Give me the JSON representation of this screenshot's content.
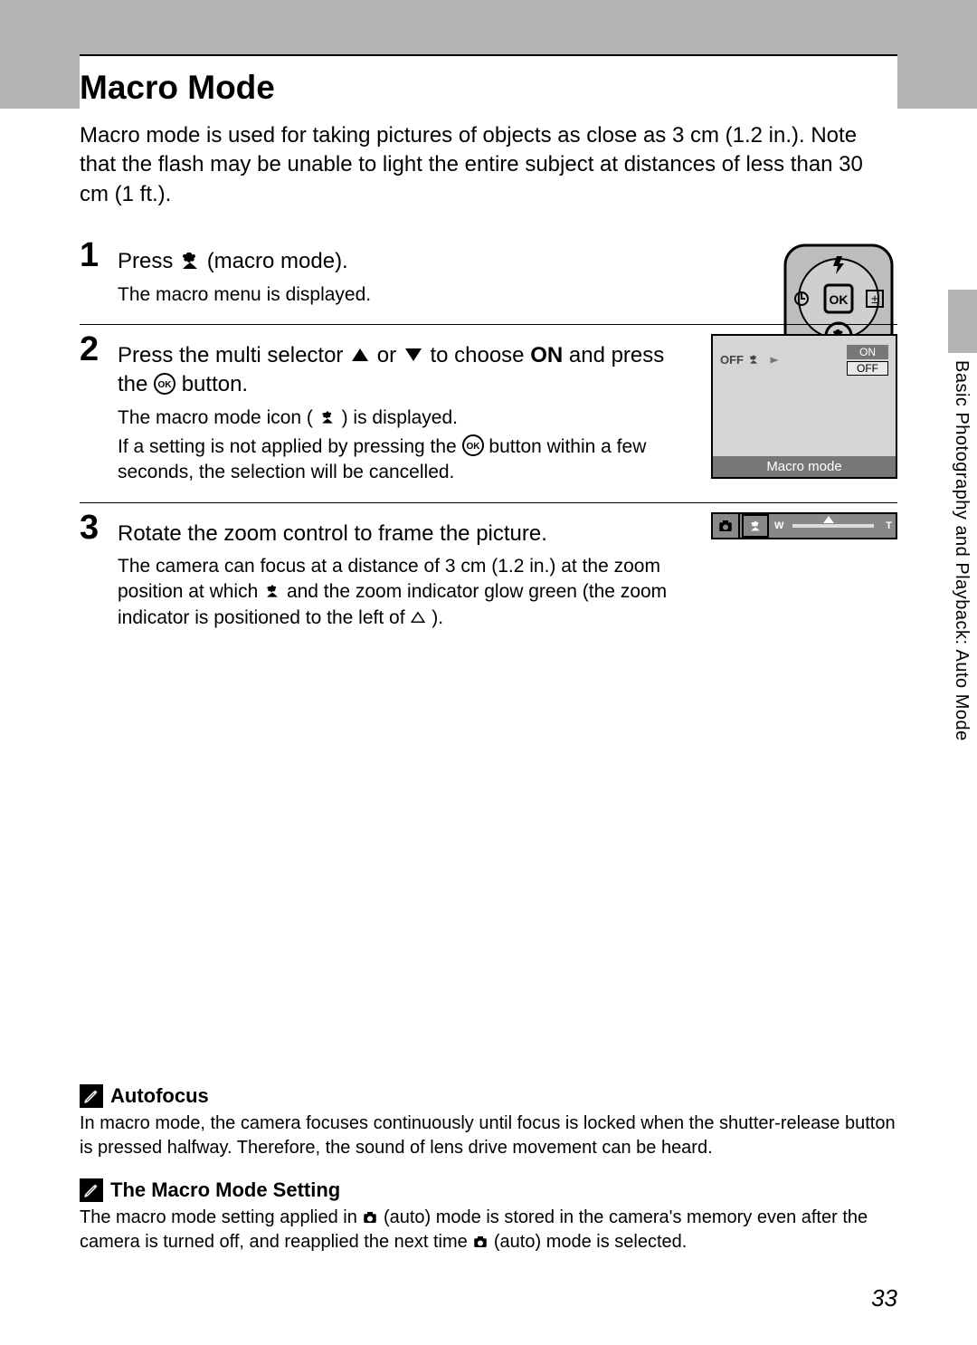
{
  "page": {
    "title": "Macro Mode",
    "intro": "Macro mode is used for taking pictures of objects as close as 3 cm (1.2 in.). Note that the flash may be unable to light the entire subject at distances of less than 30 cm (1 ft.).",
    "number": "33",
    "side_tab": "Basic Photography and Playback: Auto Mode"
  },
  "steps": {
    "s1": {
      "num": "1",
      "head_a": "Press ",
      "head_b": " (macro mode).",
      "sub": "The macro menu is displayed."
    },
    "s2": {
      "num": "2",
      "head_a": "Press the multi selector ",
      "head_or": " or ",
      "head_b": " to choose ",
      "head_on": "ON",
      "head_c": " and press the ",
      "head_d": " button.",
      "sub1_a": "The macro mode icon (",
      "sub1_b": ") is displayed.",
      "sub2_a": "If a setting is not applied by pressing the ",
      "sub2_b": " button within a few seconds, the selection will be cancelled.",
      "screen": {
        "on": "ON",
        "off": "OFF",
        "ind": "OFF",
        "footer": "Macro mode"
      }
    },
    "s3": {
      "num": "3",
      "head": "Rotate the zoom control to frame the picture.",
      "sub_a": "The camera can focus at a distance of 3 cm (1.2 in.) at the zoom position at which ",
      "sub_b": " and the zoom indicator glow green (the zoom indicator is positioned to the left of ",
      "sub_c": ").",
      "zoom": {
        "w": "W",
        "t": "T"
      }
    }
  },
  "notes": {
    "n1": {
      "title": "Autofocus",
      "body": "In macro mode, the camera focuses continuously until focus is locked when the shutter-release button is pressed halfway. Therefore, the sound of lens drive movement can be heard."
    },
    "n2": {
      "title": "The Macro Mode Setting",
      "body_a": "The macro mode setting applied in ",
      "body_b": " (auto) mode is stored in the camera's memory even after the camera is turned off, and reapplied the next time ",
      "body_c": " (auto) mode is selected."
    }
  }
}
